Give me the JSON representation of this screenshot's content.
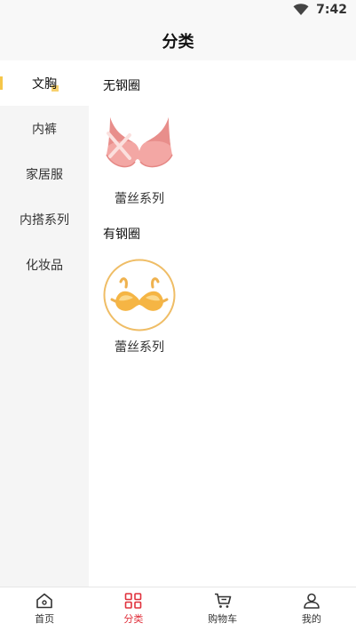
{
  "status_bar": {
    "time": "7:42",
    "icon": "wifi-icon"
  },
  "header": {
    "title": "分类"
  },
  "sidebar": {
    "accent_color": "#f5c64a",
    "items": [
      {
        "label": "文胸",
        "active": true
      },
      {
        "label": "内裤",
        "active": false
      },
      {
        "label": "家居服",
        "active": false
      },
      {
        "label": "内搭系列",
        "active": false
      },
      {
        "label": "化妆品",
        "active": false
      }
    ]
  },
  "content": {
    "groups": [
      {
        "title": "无钢圈",
        "products": [
          {
            "label": "蕾丝系列",
            "image": "pink-bra-image"
          }
        ]
      },
      {
        "title": "有钢圈",
        "products": [
          {
            "label": "蕾丝系列",
            "image": "yellow-bra-image"
          }
        ]
      }
    ]
  },
  "tabbar": {
    "active_color": "#e0313c",
    "items": [
      {
        "label": "首页",
        "icon": "home-icon",
        "active": false
      },
      {
        "label": "分类",
        "icon": "grid-icon",
        "active": true
      },
      {
        "label": "购物车",
        "icon": "cart-icon",
        "active": false
      },
      {
        "label": "我的",
        "icon": "user-icon",
        "active": false
      }
    ]
  }
}
